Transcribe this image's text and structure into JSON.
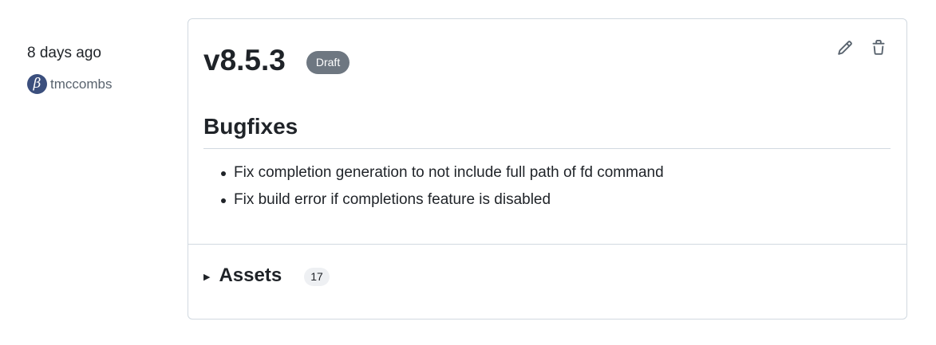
{
  "release": {
    "date": "8 days ago",
    "author": {
      "avatar_glyph": "β",
      "name": "tmccombs"
    },
    "version": "v8.5.3",
    "status_badge": "Draft",
    "actions": {
      "edit_icon": "pencil-icon",
      "delete_icon": "trash-icon"
    },
    "notes": {
      "heading": "Bugfixes",
      "items": [
        "Fix completion generation to not include full path of fd command",
        "Fix build error if completions feature is disabled"
      ]
    },
    "assets": {
      "label": "Assets",
      "count": "17"
    }
  }
}
